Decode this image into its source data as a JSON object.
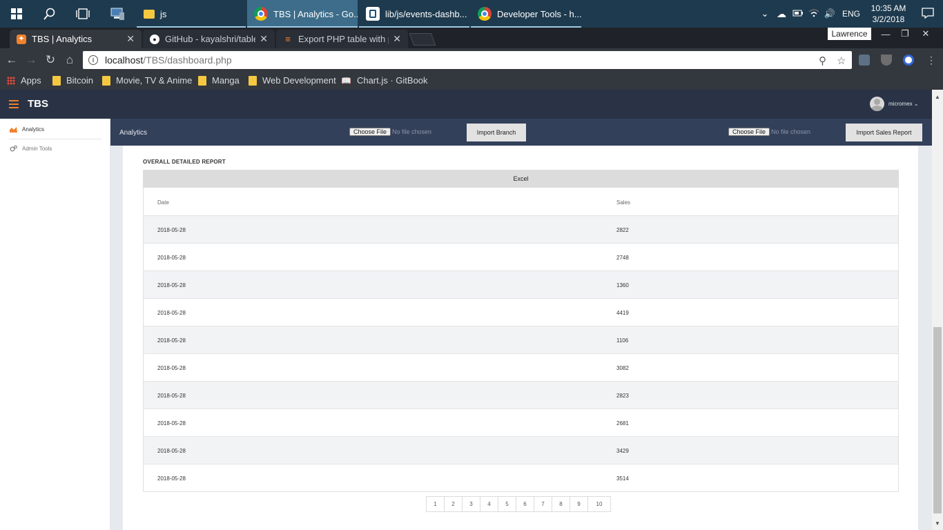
{
  "taskbar": {
    "tasks": [
      {
        "label": "js"
      },
      {
        "label": "TBS | Analytics - Go..."
      },
      {
        "label": "lib/js/events-dashb..."
      },
      {
        "label": "Developer Tools - h..."
      }
    ],
    "lang": "ENG",
    "time": "10:35 AM",
    "date": "3/2/2018"
  },
  "browser": {
    "tabs": [
      {
        "title": "TBS | Analytics"
      },
      {
        "title": "GitHub - kayalshri/tableE"
      },
      {
        "title": "Export PHP table with pa"
      }
    ],
    "profile": "Lawrence",
    "url_host": "localhost",
    "url_path": "/TBS/dashboard.php",
    "bookmarks": [
      {
        "label": "Apps"
      },
      {
        "label": "Bitcoin"
      },
      {
        "label": "Movie, TV & Anime"
      },
      {
        "label": "Manga"
      },
      {
        "label": "Web Development"
      },
      {
        "label": "Chart.js · GitBook"
      }
    ]
  },
  "app": {
    "brand": "TBS",
    "username": "micromex",
    "sidebar": [
      {
        "label": "Analytics",
        "icon": "area-chart-icon"
      },
      {
        "label": "Admin Tools",
        "icon": "gears-icon"
      }
    ],
    "subbar": {
      "title": "Analytics",
      "choose_file": "Choose File",
      "no_file": "No file chosen",
      "import_branch": "Import Branch",
      "import_sales": "Import Sales Report"
    },
    "report": {
      "title": "OVERALL DETAILED REPORT",
      "export_label": "Excel",
      "columns": [
        "Date",
        "Sales"
      ],
      "rows": [
        [
          "2018-05-28",
          "2822"
        ],
        [
          "2018-05-28",
          "2748"
        ],
        [
          "2018-05-28",
          "1360"
        ],
        [
          "2018-05-28",
          "4419"
        ],
        [
          "2018-05-28",
          "1106"
        ],
        [
          "2018-05-28",
          "3082"
        ],
        [
          "2018-05-28",
          "2823"
        ],
        [
          "2018-05-28",
          "2681"
        ],
        [
          "2018-05-28",
          "3429"
        ],
        [
          "2018-05-28",
          "3514"
        ]
      ],
      "pages": [
        "1",
        "2",
        "3",
        "4",
        "5",
        "6",
        "7",
        "8",
        "9",
        "10"
      ]
    }
  },
  "colors": {
    "appbar": "#293345",
    "subbar": "#33405a",
    "accent": "#f0812d"
  }
}
